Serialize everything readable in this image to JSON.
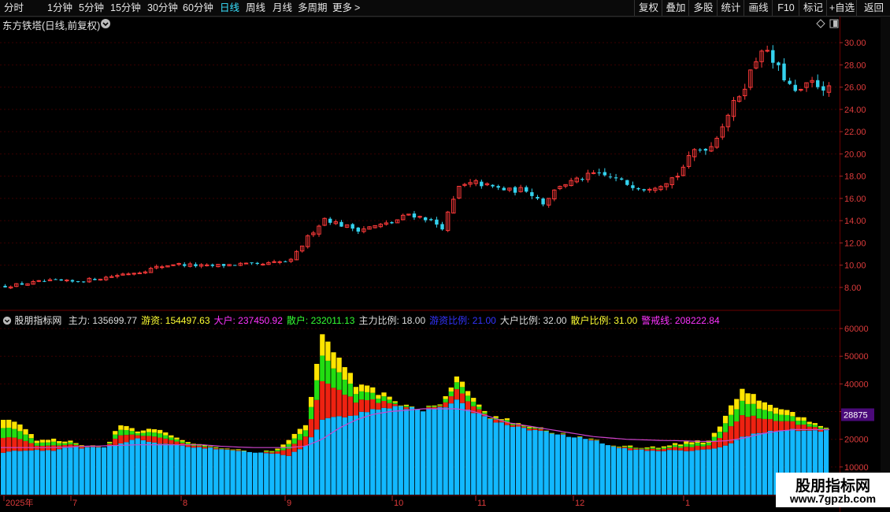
{
  "toolbar": {
    "periods": [
      {
        "label": "分时",
        "selected": false
      },
      {
        "label": "1分钟",
        "selected": false
      },
      {
        "label": "5分钟",
        "selected": false
      },
      {
        "label": "15分钟",
        "selected": false
      },
      {
        "label": "30分钟",
        "selected": false
      },
      {
        "label": "60分钟",
        "selected": false
      },
      {
        "label": "日线",
        "selected": true
      },
      {
        "label": "周线",
        "selected": false
      },
      {
        "label": "月线",
        "selected": false
      },
      {
        "label": "多周期",
        "selected": false
      },
      {
        "label": "更多",
        "selected": false
      }
    ],
    "more_arrow": ">",
    "right": [
      "复权",
      "叠加",
      "多股",
      "统计",
      "画线",
      "F10",
      "标记",
      "+自选",
      "返回"
    ]
  },
  "price_panel": {
    "title": "东方铁塔(日线,前复权)",
    "menu_icon": "chevron-down-circle-icon",
    "y_ticks": [
      "30.00",
      "28.00",
      "26.00",
      "24.00",
      "22.00",
      "20.00",
      "18.00",
      "16.00",
      "14.00",
      "12.00",
      "10.00",
      "8.00"
    ],
    "y_range": [
      7.0,
      31.0
    ]
  },
  "indicator_panel": {
    "name": "股朋指标网",
    "legend": [
      {
        "label": "主力: 135699.77",
        "color": "#dddddd"
      },
      {
        "label": "游资: 154497.63",
        "color": "#ffff33"
      },
      {
        "label": "大户: 237450.92",
        "color": "#ff33ff"
      },
      {
        "label": "散户: 232011.13",
        "color": "#33ff33"
      },
      {
        "label": "主力比例: 18.00",
        "color": "#dddddd"
      },
      {
        "label": "游资比例: 21.00",
        "color": "#3333ff"
      },
      {
        "label": "大户比例: 32.00",
        "color": "#dddddd"
      },
      {
        "label": "散户比例: 31.00",
        "color": "#ffff33"
      },
      {
        "label": "警戒线: 208222.84",
        "color": "#ff33ff"
      }
    ],
    "y_ticks": [
      "60000",
      "50000",
      "40000",
      "30000",
      "20000",
      "10000"
    ],
    "y_range": [
      0,
      64000
    ],
    "current_value_label": "28875",
    "current_value": 28875
  },
  "x_axis": {
    "labels": [
      "2025年",
      "7",
      "8",
      "9",
      "10",
      "11",
      "12",
      "1"
    ]
  },
  "watermark": {
    "title": "股朋指标网",
    "url": "www.7gpzb.com"
  },
  "colors": {
    "up": "#ff3a3a",
    "down": "#34d2ee",
    "bar_blue": "#12b8ff",
    "bar_red": "#ee2211",
    "bar_green": "#22dd11",
    "bar_yellow": "#ffe400",
    "warning_line": "#cc44cc",
    "grid": "#3a0000"
  },
  "chart_data": [
    {
      "type": "candlestick",
      "title": "东方铁塔(日线,前复权)",
      "ylim": [
        7.0,
        31.0
      ],
      "x_labels": [
        "2025年",
        "7",
        "8",
        "9",
        "10",
        "11",
        "12",
        "1"
      ],
      "close_path": [
        8.1,
        8.3,
        8.5,
        8.6,
        8.5,
        8.7,
        8.9,
        9.2,
        9.4,
        9.8,
        10.1,
        10.0,
        9.9,
        10.0,
        10.1,
        10.0,
        10.2,
        10.4,
        12.5,
        14.2,
        13.6,
        13.2,
        13.5,
        13.8,
        14.6,
        14.2,
        13.4,
        17.0,
        17.4,
        17.0,
        16.7,
        16.8,
        15.6,
        17.2,
        17.6,
        18.2,
        17.9,
        17.3,
        16.9,
        17.3,
        18.1,
        20.3,
        20.7,
        23.6,
        26.2,
        29.6,
        27.6,
        25.4,
        26.4,
        25.8
      ]
    },
    {
      "type": "stacked bar",
      "series_colors": [
        "#12b8ff",
        "#ee2211",
        "#22dd11",
        "#ffe400"
      ],
      "ylim": [
        0,
        64000
      ],
      "current_value": 28875,
      "total_path": [
        27000,
        25000,
        20000,
        20000,
        19000,
        17500,
        17000,
        25000,
        23000,
        24000,
        22000,
        19000,
        18000,
        17000,
        16000,
        15500,
        15500,
        20000,
        25000,
        57000,
        50000,
        40000,
        38000,
        35000,
        32000,
        31000,
        32000,
        43000,
        35000,
        28000,
        27000,
        25000,
        24000,
        22000,
        21000,
        20000,
        18000,
        17500,
        17000,
        17000,
        18500,
        19000,
        19500,
        28000,
        38000,
        35000,
        32000,
        30000,
        26000,
        24000
      ],
      "blue_path": [
        15000,
        16000,
        16000,
        16000,
        17000,
        17000,
        17500,
        18500,
        20000,
        19000,
        18000,
        17500,
        17000,
        16500,
        16000,
        15500,
        15000,
        14000,
        18000,
        27000,
        28000,
        29000,
        31000,
        31500,
        31500,
        31000,
        31000,
        34000,
        30000,
        27000,
        25000,
        24000,
        23000,
        22000,
        21000,
        20000,
        18000,
        16500,
        16000,
        16000,
        16000,
        16000,
        16500,
        17500,
        21000,
        22000,
        23000,
        23500,
        23000,
        23000
      ],
      "warning_line_path": [
        17000,
        17000,
        17000,
        17000,
        17200,
        17500,
        17600,
        17800,
        18000,
        18000,
        18000,
        18000,
        18000,
        17500,
        17200,
        17000,
        17000,
        17000,
        17500,
        20000,
        24000,
        27000,
        29000,
        30000,
        30500,
        31000,
        31000,
        31000,
        30000,
        28000,
        26000,
        25000,
        24000,
        23000,
        22000,
        21000,
        20500,
        20000,
        19800,
        19600,
        19500,
        19300,
        19200,
        19500,
        20500,
        22000,
        23000,
        23500,
        23500,
        23500
      ]
    }
  ]
}
